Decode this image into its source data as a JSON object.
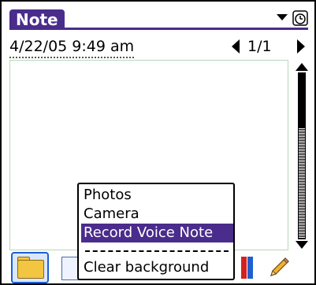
{
  "title": "Note",
  "header": {
    "date": "4/22/05 9:49 am",
    "page_count": "1/1"
  },
  "popup_menu": {
    "items": [
      {
        "label": "Photos",
        "selected": false
      },
      {
        "label": "Camera",
        "selected": false
      },
      {
        "label": "Record Voice Note",
        "selected": true
      },
      {
        "label": "Clear background",
        "selected": false
      }
    ]
  },
  "colors": {
    "accent": "#4a2c8c",
    "selection": "#4a2c8c"
  },
  "icons": [
    "menu-arrow-icon",
    "clock-icon",
    "prev-page-arrow-icon",
    "next-page-arrow-icon",
    "folder-icon",
    "document-icon",
    "color-icon",
    "pencil-icon"
  ]
}
